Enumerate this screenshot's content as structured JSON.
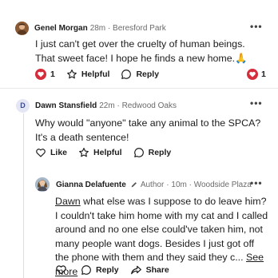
{
  "comments": [
    {
      "author": "Genel Morgan",
      "meta": "28m · Beresford Park",
      "text": "I just can't get over the cruelty of human beings. That sweet face! I hope he finds a new home.🙏",
      "reactions_count": "1",
      "helpful_label": "Helpful",
      "reply_label": "Reply",
      "right_reactions_count": "1"
    },
    {
      "author": "Dawn Stansfield",
      "avatar_letter": "D",
      "meta": "22m · Redwood Oaks",
      "text": "Why would \"anyone\" take any animal to the SPCA? It's a death sentence!",
      "like_label": "Like",
      "helpful_label": "Helpful",
      "reply_label": "Reply"
    },
    {
      "author": "Gianna Delafuente",
      "author_tag": "Author",
      "meta": "· 10m · Woodside Plaza",
      "mention": "Dawn",
      "text": " what else was I suppose to do leave him? I couldn't take him home with my cat and I called around and no one else could've taken him, not many people want dogs. Besides I just got off the phone with them and they said they c... ",
      "see_more": "See more",
      "reply_label": "Reply",
      "share_label": "Share"
    }
  ],
  "more_label": "•••",
  "colors": {
    "avatar_bg": "#e4e6f5",
    "avatar_letter": "#3d4a8a",
    "heart_red": "#d62d3c"
  }
}
